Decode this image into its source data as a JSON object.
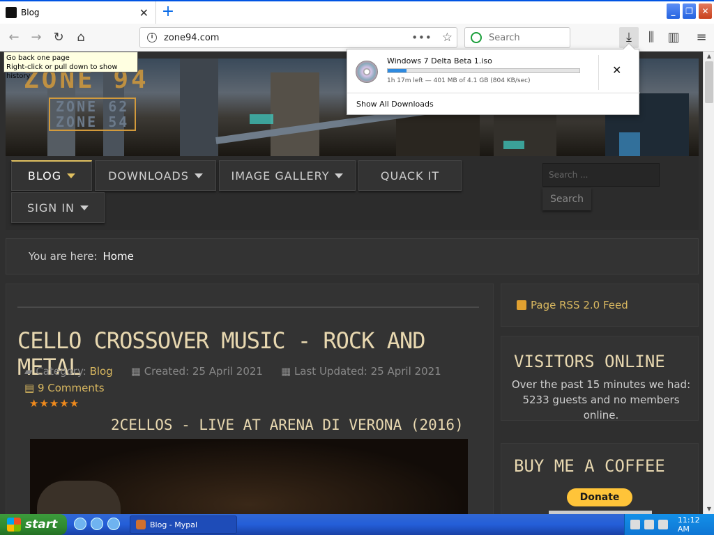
{
  "browser": {
    "tab_title": "Blog",
    "url": "zone94.com",
    "search_placeholder": "Search",
    "tooltip_line1": "Go back one page",
    "tooltip_line2": "Right-click or pull down to show history"
  },
  "downloads": {
    "file_name": "Windows 7 Delta Beta 1.iso",
    "status": "1h 17m left — 401 MB of 4.1 GB (804 KB/sec)",
    "progress_fraction": 0.098,
    "show_all": "Show All Downloads"
  },
  "site": {
    "logo_main": "ZONE 94",
    "logo_sub1": "ZONE 62",
    "logo_sub2": "ZONE 54",
    "menu": {
      "blog": "BLOG",
      "downloads": "DOWNLOADS",
      "gallery": "IMAGE GALLERY",
      "quack": "QUACK IT",
      "signin": "SIGN IN"
    },
    "search_placeholder": "Search ...",
    "search_button": "Search",
    "breadcrumb_prefix": "You are here:",
    "breadcrumb_home": "Home"
  },
  "article": {
    "title": "CELLO CROSSOVER MUSIC - ROCK AND METAL",
    "category_label": "Category:",
    "category": "Blog",
    "created": "Created: 25 April 2021",
    "updated": "Last Updated: 25 April 2021",
    "comments": "9 Comments",
    "rating": "★★★★★",
    "subtitle": "2CELLOS - LIVE AT ARENA DI VERONA (2016)"
  },
  "sidebar": {
    "rss": "Page RSS 2.0 Feed",
    "visitors_title": "VISITORS ONLINE",
    "visitors_text": "Over the past 15 minutes we had: 5233 guests and no members online.",
    "coffee_title": "BUY ME A COFFEE",
    "donate": "Donate"
  },
  "taskbar": {
    "start": "start",
    "task": "Blog - Mypal",
    "clock": "11:12 AM"
  }
}
